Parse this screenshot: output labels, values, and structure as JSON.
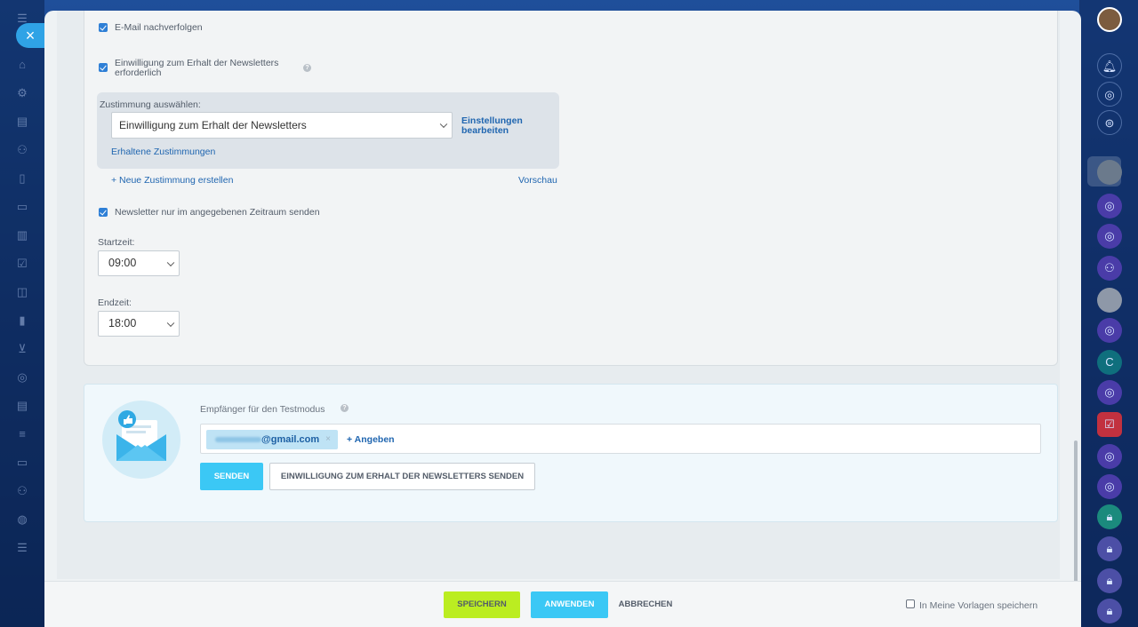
{
  "settings": {
    "track_email_label": "E-Mail nachverfolgen",
    "consent_required_label": "Einwilligung zum Erhalt der Newsletters erforderlich",
    "consent_required_line1": "Einwilligung zum Erhalt der Newsletters",
    "consent_required_line2": "erforderlich",
    "choose_consent_label": "Zustimmung auswählen:",
    "consent_select_value": "Einwilligung zum Erhalt der Newsletters",
    "edit_settings_line1": "Einstellungen",
    "edit_settings_line2": "bearbeiten",
    "received_consents_link": "Erhaltene Zustimmungen",
    "new_consent_link": "+ Neue Zustimmung erstellen",
    "preview_link": "Vorschau",
    "time_window_label": "Newsletter nur im angegebenen Zeitraum senden",
    "start_time_label": "Startzeit:",
    "start_time_value": "09:00",
    "end_time_label": "Endzeit:",
    "end_time_value": "18:00"
  },
  "test_mode": {
    "title": "Empfänger für den Testmodus",
    "email_suffix": "@gmail.com",
    "add_label": "+ Angeben",
    "send_button": "SENDEN",
    "send_consent_button": "EINWILLIGUNG ZUM ERHALT DER NEWSLETTERS SENDEN"
  },
  "footer": {
    "save_button": "SPEICHERN",
    "apply_button": "ANWENDEN",
    "cancel_button": "ABBRECHEN",
    "save_template_label": "In Meine Vorlagen speichern"
  },
  "right_rail": {
    "c_label": "C"
  },
  "colors": {
    "accent_blue": "#2e7fd6",
    "link_blue": "#2066b0",
    "send_button": "#3bc8f5",
    "save_button": "#bbed21",
    "apply_button": "#3bc8f5"
  }
}
